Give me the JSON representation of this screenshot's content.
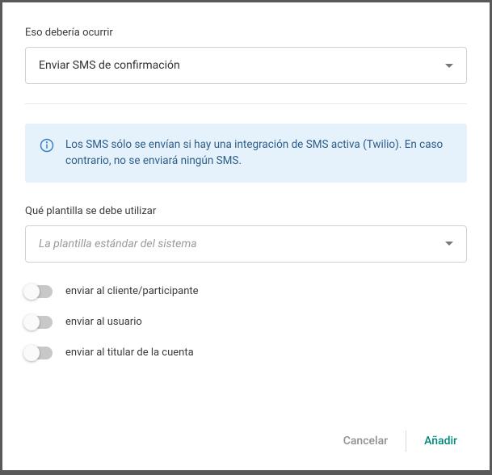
{
  "action": {
    "label": "Eso debería ocurrir",
    "selected": "Enviar SMS de confirmación"
  },
  "infoBox": {
    "text": "Los SMS sólo se envían si hay una integración de SMS activa (Twilio). En caso contrario, no se enviará ningún SMS."
  },
  "template": {
    "label": "Qué plantilla se debe utilizar",
    "placeholder": "La plantilla estándar del sistema"
  },
  "toggles": {
    "client": "enviar al cliente/participante",
    "user": "enviar al usuario",
    "account": "enviar al titular de la cuenta"
  },
  "footer": {
    "cancel": "Cancelar",
    "add": "Añadir"
  },
  "colors": {
    "infoBg": "#e5f2fb",
    "infoText": "#2c5d8a",
    "primary": "#00897b"
  }
}
